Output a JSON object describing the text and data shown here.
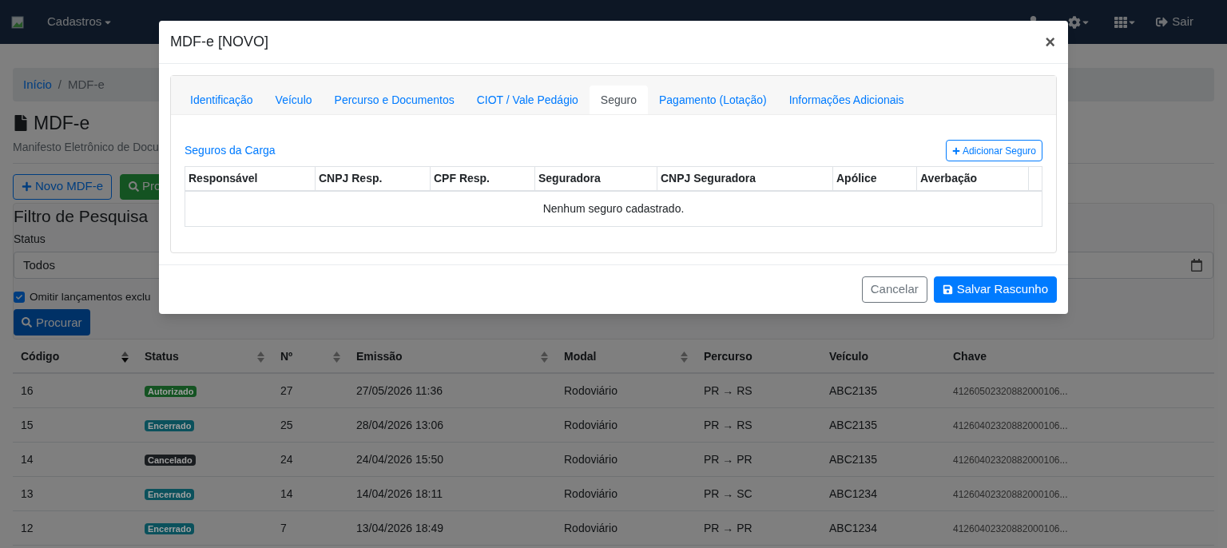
{
  "navbar": {
    "menu": [
      {
        "label": "Cadastros",
        "dropdown": true
      }
    ],
    "logout": "Sair"
  },
  "breadcrumb": {
    "separator": "/",
    "items": [
      {
        "label": "Início",
        "link": true
      },
      {
        "label": "MDF-e",
        "link": false
      }
    ]
  },
  "page": {
    "title": "MDF-e",
    "subtitle": "Manifesto Eletrônico de Docu",
    "buttons": [
      {
        "label": "Novo MDF-e",
        "kind": "outline"
      },
      {
        "label": "Pro",
        "kind": "success"
      }
    ]
  },
  "filter": {
    "title": "Filtro de Pesquisa",
    "status_label": "Status",
    "status_value": "Todos",
    "omit_deleted": {
      "label": "Omitir lançamentos exclu",
      "checked": true
    },
    "search_button": "Procurar"
  },
  "table": {
    "columns": [
      {
        "label": "Código",
        "sortable": true,
        "sorted": true
      },
      {
        "label": "Status",
        "sortable": true,
        "sorted": false
      },
      {
        "label": "Nº",
        "sortable": true,
        "sorted": false
      },
      {
        "label": "Emissão",
        "sortable": true,
        "sorted": false
      },
      {
        "label": "Modal",
        "sortable": true,
        "sorted": false
      },
      {
        "label": "Percurso",
        "sortable": false
      },
      {
        "label": "Veículo",
        "sortable": false
      },
      {
        "label": "Chave",
        "sortable": false
      }
    ],
    "rows": [
      {
        "codigo": "16",
        "status": "Autorizado",
        "color": "#145322",
        "numero": "27",
        "emissao": "27/05/2026 11:36",
        "modal": "Rodoviário",
        "percurso": "PR → RS",
        "veiculo": "ABC2135",
        "chave": "41260502320882000106..."
      },
      {
        "codigo": "15",
        "status": "Encerrado",
        "color": "#0b515c",
        "numero": "25",
        "emissao": "28/04/2026 13:06",
        "modal": "Rodoviário",
        "percurso": "PR → RS",
        "veiculo": "ABC2135",
        "chave": "41260402320882000106..."
      },
      {
        "codigo": "14",
        "status": "Cancelado",
        "color": "#1a1d20",
        "numero": "24",
        "emissao": "24/04/2026 15:50",
        "modal": "Rodoviário",
        "percurso": "PR → PR",
        "veiculo": "ABC2135",
        "chave": "41260402320882000106..."
      },
      {
        "codigo": "13",
        "status": "Encerrado",
        "color": "#0b515c",
        "numero": "14",
        "emissao": "14/04/2026 18:11",
        "modal": "Rodoviário",
        "percurso": "PR → SC",
        "veiculo": "ABC1234",
        "chave": "41260402320882000106..."
      },
      {
        "codigo": "12",
        "status": "Encerrado",
        "color": "#0b515c",
        "numero": "7",
        "emissao": "13/04/2026 18:49",
        "modal": "Rodoviário",
        "percurso": "PR → PR",
        "veiculo": "ABC1234",
        "chave": "41260402320882000106..."
      }
    ]
  },
  "modal": {
    "title": "MDF-e [NOVO]",
    "close": "×",
    "tabs": [
      {
        "label": "Identificação",
        "selected": false
      },
      {
        "label": "Veículo",
        "selected": false
      },
      {
        "label": "Percurso e Documentos",
        "selected": false
      },
      {
        "label": "CIOT / Vale Pedágio",
        "selected": false
      },
      {
        "label": "Seguro",
        "selected": true
      },
      {
        "label": "Pagamento (Lotação)",
        "selected": false
      },
      {
        "label": "Informações Adicionais",
        "selected": false
      }
    ],
    "section_title": "Seguros da Carga",
    "add_button": "Adicionar Seguro",
    "columns": [
      "Responsável",
      "CNPJ Resp.",
      "CPF Resp.",
      "Seguradora",
      "CNPJ Seguradora",
      "Apólice",
      "Averbação"
    ],
    "empty_message": "Nenhum seguro cadastrado.",
    "buttons": [
      {
        "label": "Cancelar",
        "kind": "secondary"
      },
      {
        "label": "Salvar Rascunho",
        "kind": "primary"
      }
    ]
  }
}
